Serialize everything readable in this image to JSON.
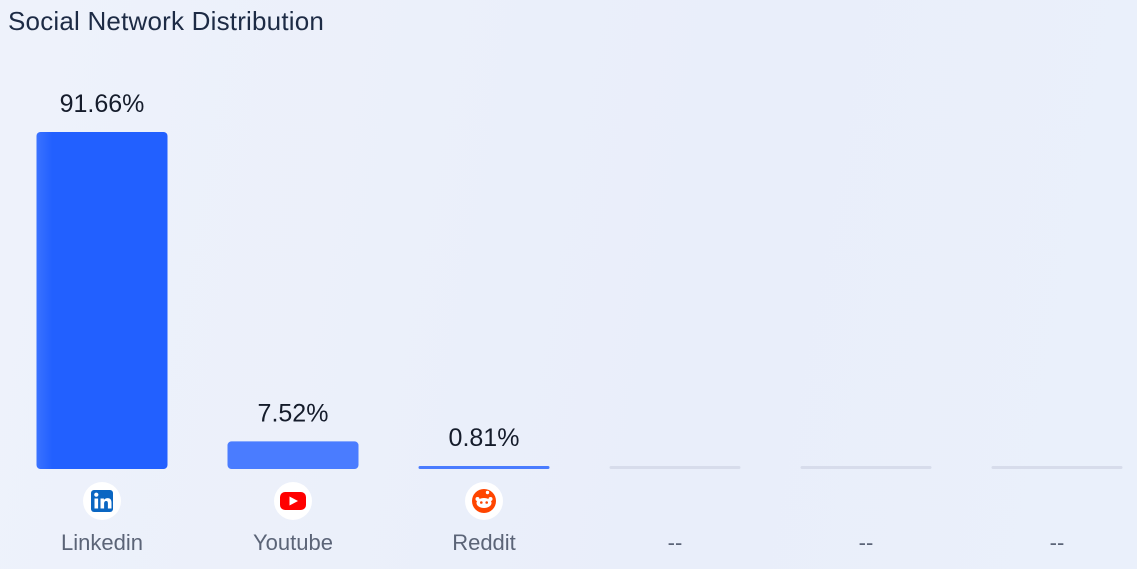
{
  "title": "Social Network Distribution",
  "chart_data": {
    "type": "bar",
    "title": "Social Network Distribution",
    "categories": [
      "Linkedin",
      "Youtube",
      "Reddit",
      "--",
      "--",
      "--"
    ],
    "values": [
      91.66,
      7.52,
      0.81,
      null,
      null,
      null
    ],
    "value_labels": [
      "91.66%",
      "7.52%",
      "0.81%",
      "",
      "",
      ""
    ],
    "icons": [
      "linkedin-icon",
      "youtube-icon",
      "reddit-icon",
      "",
      "",
      ""
    ],
    "ylim": [
      0,
      91.66
    ],
    "grid": false,
    "colors": {
      "bar": "#2260ff",
      "bar_light": "#4a7cff",
      "placeholder": "#d7dceb",
      "linkedin": "#0a66c2",
      "youtube": "#ff0000",
      "reddit": "#ff4500"
    }
  }
}
